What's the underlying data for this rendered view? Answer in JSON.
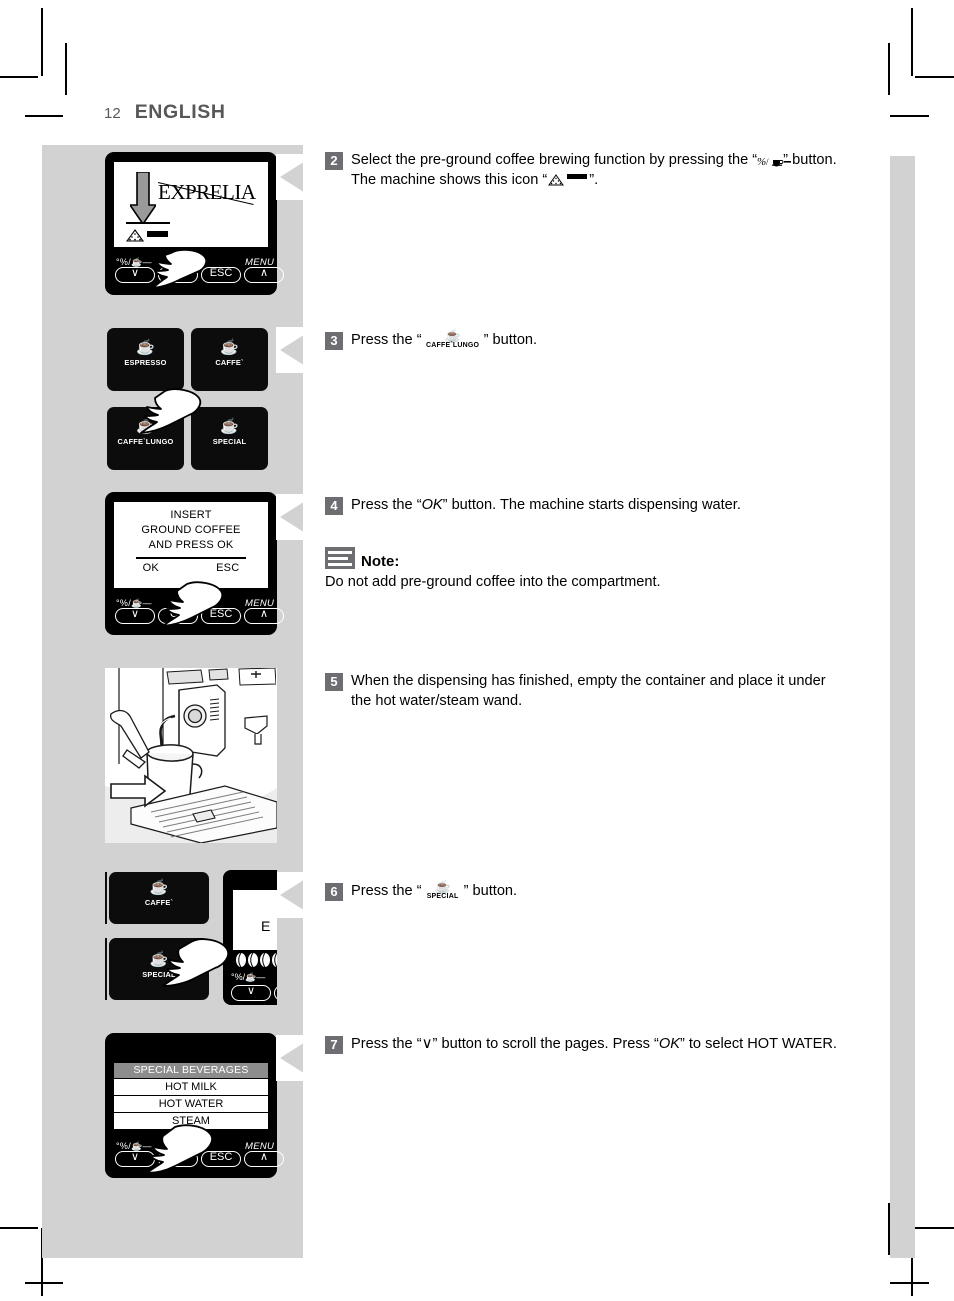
{
  "header": {
    "page_number": "12",
    "language": "ENGLISH"
  },
  "colors": {
    "band_gray": "#d2d2d2",
    "step_badge_gray": "#6d6e71",
    "header_gray": "#58585a",
    "lcd_black": "#000000"
  },
  "steps": [
    {
      "number": "2",
      "text_before": "Select the pre-ground coffee brewing function by pressing the “",
      "icon_1": "pre-ground-coffee-button-icon",
      "text_middle": "” button. The machine shows this icon “",
      "icon_2": "pre-ground-coffee-status-icon",
      "text_after": "”."
    },
    {
      "number": "3",
      "text_before": "Press the “",
      "icon_glyph": "☕",
      "icon_label": "CAFFE`LUNGO",
      "text_after": "” button."
    },
    {
      "number": "4",
      "text_before": "Press the “",
      "emphasis": "OK",
      "text_after": "” button. The machine starts dispensing water."
    },
    {
      "number": "5",
      "text": "When the dispensing has finished, empty the container and place it under the hot water/steam wand."
    },
    {
      "number": "6",
      "text_before": "Press the “",
      "icon_glyph": "☕",
      "icon_label": "SPECIAL",
      "text_after": "” button."
    },
    {
      "number": "7",
      "text_before": "Press the “",
      "scroll_glyph": "∨",
      "text_middle": "” button to scroll the pages. Press “",
      "emphasis": "OK",
      "text_after": "” to select HOT WATER."
    }
  ],
  "note": {
    "icon": "note-icon",
    "title": "Note:",
    "body": "Do not add pre-ground coffee into the compartment."
  },
  "figures": {
    "fig1": {
      "name": "display-exprelia",
      "screen_brand": "EXPRELIA",
      "screen_arrow": "down-arrow-icon",
      "status_icon": "pre-ground-coffee-icon",
      "soft_keys": [
        "∨",
        "OK",
        "ESC",
        "∧"
      ],
      "key_caps": {
        "left": "°%/☕—",
        "right": "MENU"
      },
      "hand": "pointing-hand-icon"
    },
    "fig2": {
      "name": "button-panel-coffee-selection",
      "buttons": [
        {
          "label": "ESPRESSO",
          "glyph": "☕"
        },
        {
          "label": "CAFFE`",
          "glyph": "☕"
        },
        {
          "label": "CAFFE`LUNGO",
          "glyph": "☕"
        },
        {
          "label": "SPECIAL",
          "glyph": "☕"
        }
      ],
      "hand": "pointing-hand-icon",
      "hand_target": "CAFFE`LUNGO"
    },
    "fig3": {
      "name": "display-insert-ground-coffee",
      "screen_lines": [
        "INSERT",
        "GROUND COFFEE",
        "AND PRESS OK"
      ],
      "screen_options": [
        "OK",
        "ESC"
      ],
      "soft_keys": [
        "∨",
        "OK",
        "ESC",
        "∧"
      ],
      "key_caps": {
        "left": "°%/☕—",
        "right": "MENU"
      },
      "hand": "pointing-hand-icon",
      "hand_target": "OK"
    },
    "fig4": {
      "name": "machine-pitcher-under-steam-wand",
      "caption": "",
      "arrow": "insert-arrow-icon"
    },
    "fig5": {
      "name": "button-panel-special",
      "buttons": [
        {
          "label": "CAFFE`",
          "glyph": "☕"
        },
        {
          "label": "SPECIAL",
          "glyph": "☕"
        }
      ],
      "side_display_letter": "E",
      "bean_icons": "coffee-bean-strength-icons",
      "soft_key": "∨",
      "key_cap_left": "°%/☕—",
      "hand": "pointing-hand-icon",
      "hand_target": "SPECIAL"
    },
    "fig6": {
      "name": "display-special-beverages",
      "list_title": "SPECIAL BEVERAGES",
      "list_items": [
        "HOT MILK",
        "HOT WATER",
        "STEAM"
      ],
      "soft_keys": [
        "∨",
        "OK",
        "ESC",
        "∧"
      ],
      "key_caps": {
        "left": "°%/☕—",
        "right": "MENU"
      },
      "hand": "pointing-hand-icon",
      "hand_target": "∨"
    }
  }
}
